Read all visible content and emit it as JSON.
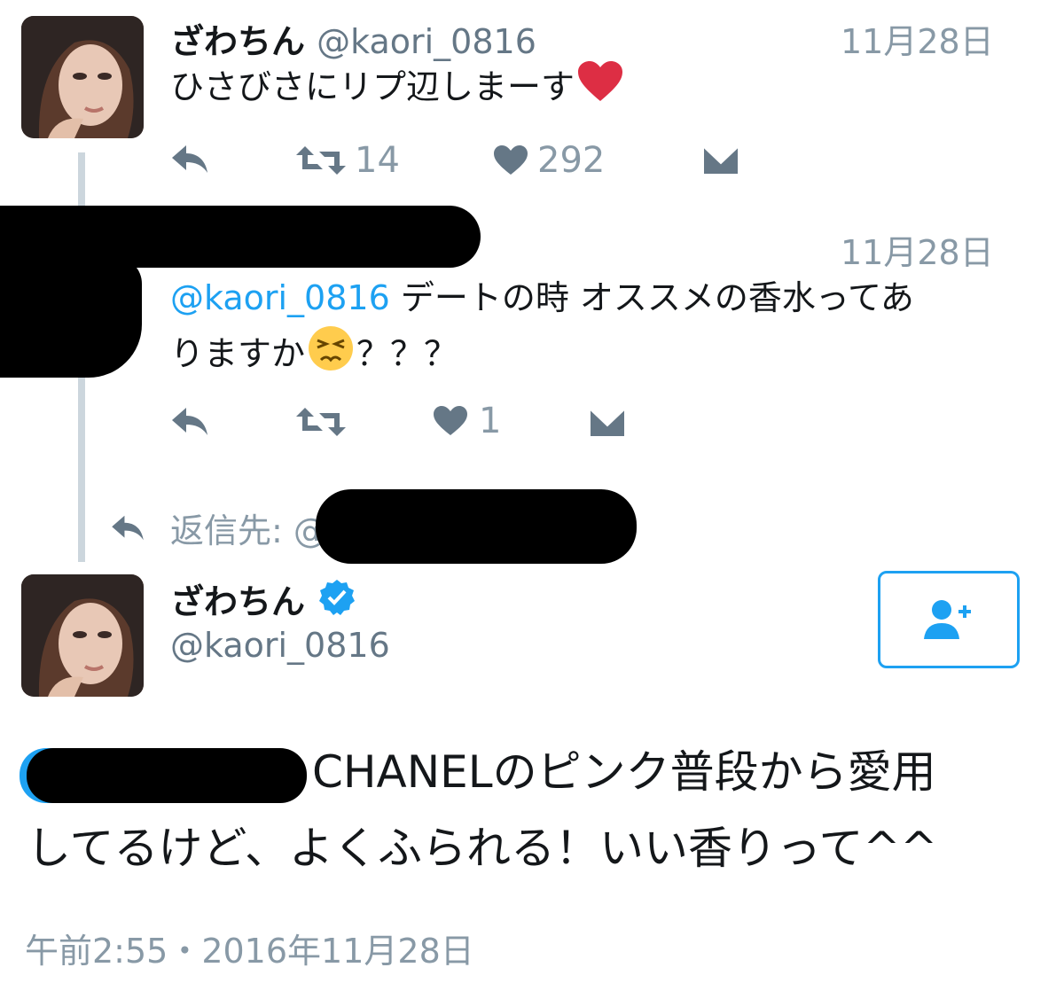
{
  "tweet1": {
    "name": "ざわちん",
    "handle": "@kaori_0816",
    "date": "11月28日",
    "text": "ひさびさにリプ辺しまーす",
    "retweets": "14",
    "likes": "292"
  },
  "tweet2": {
    "date": "11月28日",
    "mention": "@kaori_0816",
    "text_line1": " デートの時 オススメの香水ってあ",
    "text_line2": "りますか",
    "text_line2_tail": "？？？",
    "likes": "1"
  },
  "reply_to": {
    "label": "返信先: @"
  },
  "tweet3": {
    "name": "ざわちん",
    "handle": "@kaori_0816",
    "line1": "CHANELのピンク普段から愛用",
    "line2": "してるけど、よくふられる！いい香りって^^",
    "timestamp": "午前2:55・2016年11月28日"
  },
  "colors": {
    "accent": "#1da1f2",
    "muted": "#8899a6",
    "heart": "#e0245e"
  },
  "icons": {
    "reply": "reply-icon",
    "retweet": "retweet-icon",
    "like": "heart-icon",
    "dm": "envelope-icon",
    "verified": "verified-badge-icon",
    "follow": "add-user-icon",
    "emoji_heart": "red-heart-emoji",
    "emoji_persevere": "persevering-face-emoji"
  }
}
